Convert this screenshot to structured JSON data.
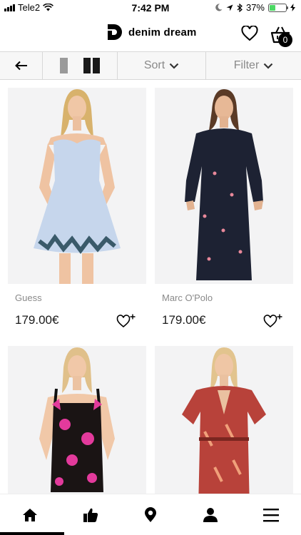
{
  "status_bar": {
    "carrier": "Tele2",
    "time": "7:42 PM",
    "battery_percent": "37%",
    "battery_level": 0.37,
    "battery_color": "#4cd964",
    "icons": [
      "signal-icon",
      "wifi-icon",
      "moon-icon",
      "location-icon",
      "bluetooth-icon",
      "battery-icon",
      "charging-icon"
    ]
  },
  "header": {
    "brand_name": "denim dream",
    "cart_count": "0",
    "icons": [
      "brand-logo-icon",
      "heart-icon",
      "basket-icon"
    ]
  },
  "toolbar": {
    "back_icon": "arrow-left-icon",
    "view_single_icon": "single-column-icon",
    "view_grid_icon": "two-column-icon",
    "sort_label": "Sort",
    "filter_label": "Filter"
  },
  "products": [
    {
      "brand": "Guess",
      "price": "179.00€",
      "dress_color": "#c6d6ec",
      "image_desc": "light blue strapless butterfly print dress"
    },
    {
      "brand": "Marc O'Polo",
      "price": "179.00€",
      "dress_color": "#1d2233",
      "image_desc": "navy floral wrap dress"
    },
    {
      "brand": "",
      "price": "",
      "dress_color": "#1a1414",
      "image_desc": "black floral pink print dress"
    },
    {
      "brand": "",
      "price": "",
      "dress_color": "#b8423a",
      "image_desc": "red patterned wrap dress"
    }
  ],
  "bottom_nav": {
    "items": [
      "home-icon",
      "thumbs-up-icon",
      "location-pin-icon",
      "user-icon",
      "menu-icon"
    ]
  }
}
